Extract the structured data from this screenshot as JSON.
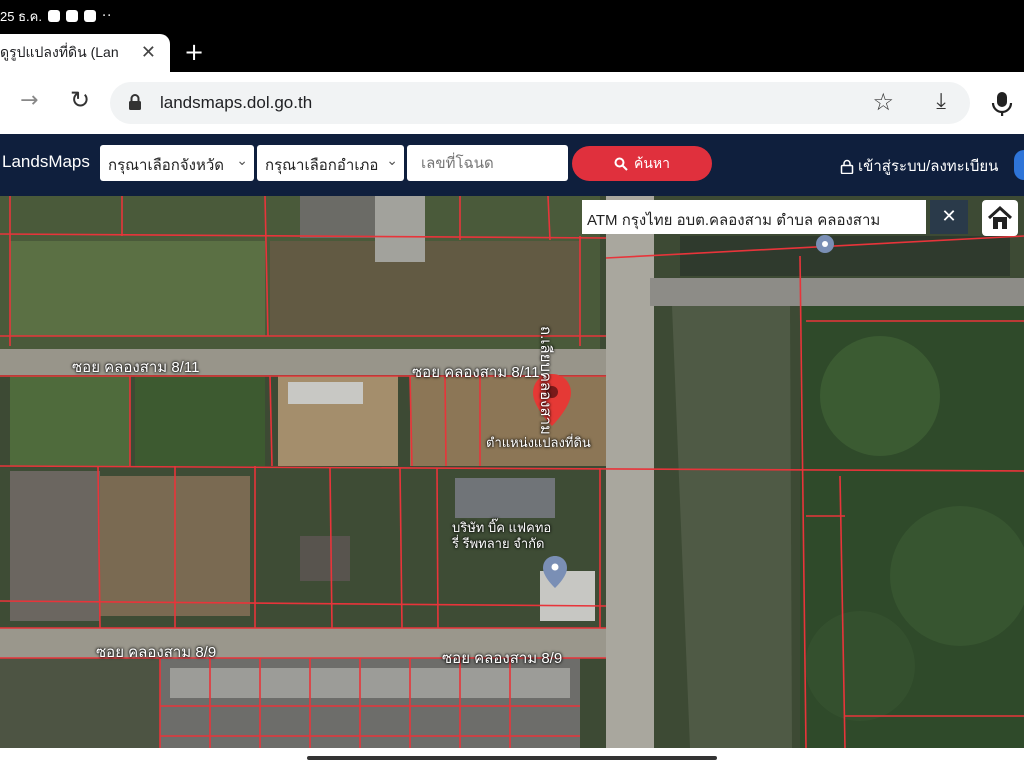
{
  "status_bar": {
    "time": "25 ธ.ค.",
    "more": "··"
  },
  "browser": {
    "tab_title": "ดูรูปแปลงที่ดิน (Lan",
    "tab_close": "✕",
    "new_tab": "+",
    "url": "landsmaps.dol.go.th",
    "forward": "→",
    "reload": "↻",
    "bookmark": "☆",
    "download": "⤓"
  },
  "site_header": {
    "brand": "LandsMaps",
    "province_select": "กรุณาเลือกจังหวัด",
    "district_select": "กรุณาเลือกอำเภอ",
    "deed_placeholder": "เลขที่โฉนด",
    "search_label": "ค้นหา",
    "login_label": "เข้าสู่ระบบ/ลงทะเบียน",
    "chevron": "⌄"
  },
  "map": {
    "info_tooltip": "ATM กรุงไทย อบต.คลองสาม ตำบล คลองสาม",
    "tooltip_close": "✕",
    "road_labels": {
      "soi_8_11_left": "ซอย คลองสาม 8/11",
      "soi_8_11_right": "ซอย คลองสาม 8/11",
      "soi_8_9_left": "ซอย คลองสาม 8/9",
      "soi_8_9_right": "ซอย คลองสาม 8/9",
      "main_road": "ถ.เลียบคลองสาม"
    },
    "poi_labels": {
      "parcel": "ตำแหน่งแปลงที่ดิน",
      "company": "บริษัท บิ๊ค แฟคทอ\nรี่ รีพทลาย จำกัด"
    },
    "colors": {
      "parcel_line": "#e8343a",
      "marker": "#e53935",
      "info_marker": "#7a8fb5"
    }
  }
}
